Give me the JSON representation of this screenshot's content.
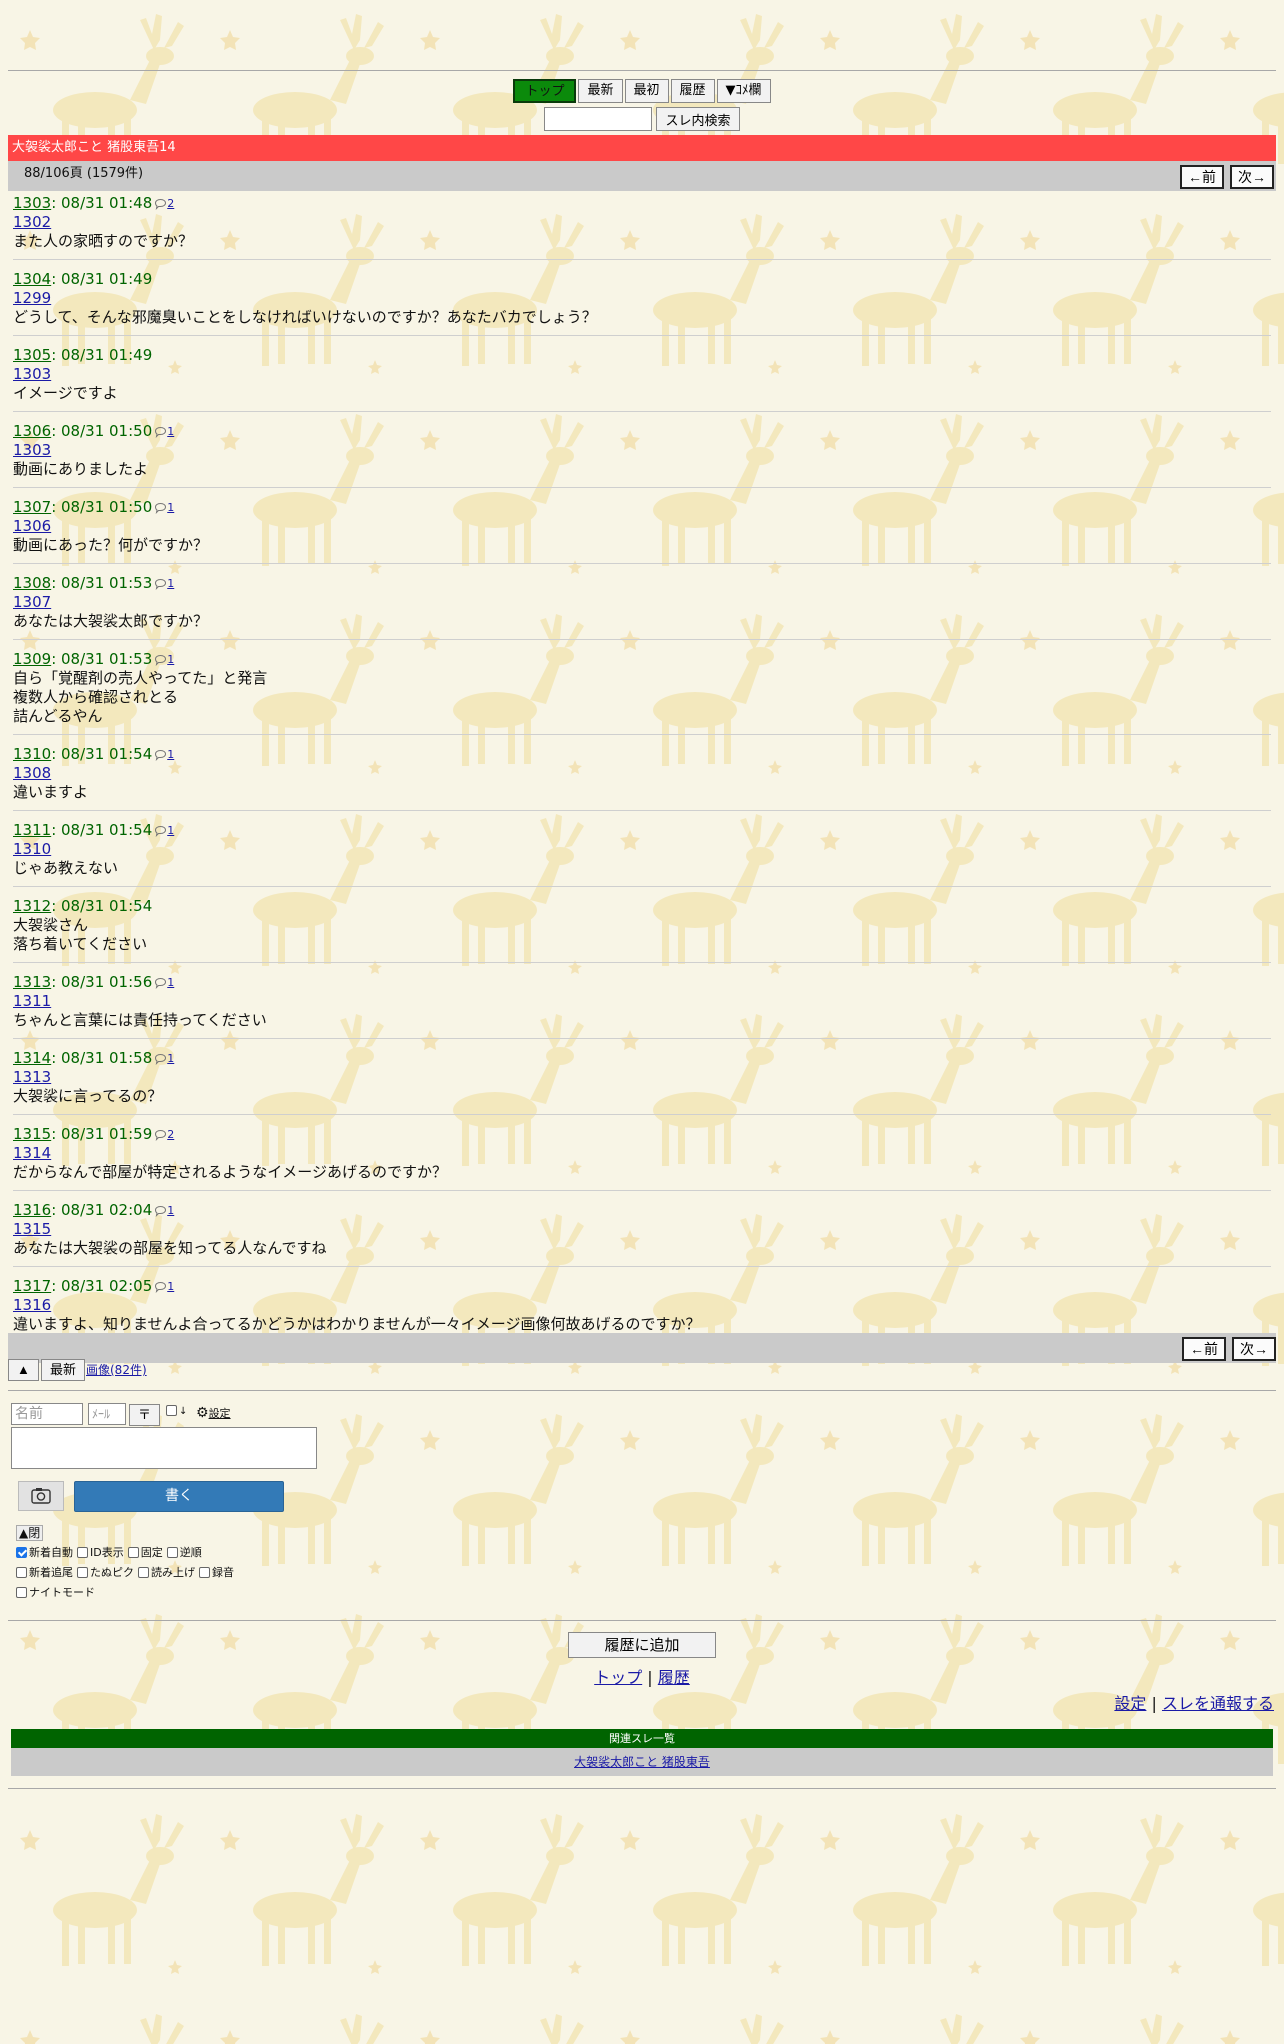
{
  "nav": {
    "buttons": [
      "トップ",
      "最新",
      "最初",
      "履歴",
      "▼ｺﾒ欄"
    ],
    "search_button": "スレ内検索"
  },
  "thread": {
    "title": "大袈裟太郎こと 猪股東吾14",
    "page_info": "88/106頁 (1579件)",
    "prev_label": "←前",
    "next_label": "次→"
  },
  "posts": [
    {
      "num": "1303",
      "datetime": "08/31 01:48",
      "reply_count": "2",
      "anchor": "1302",
      "body": "また人の家晒すのですか？"
    },
    {
      "num": "1304",
      "datetime": "08/31 01:49",
      "reply_count": "",
      "anchor": "1299",
      "body": "どうして、そんな邪魔臭いことをしなければいけないのですか？あなたバカでしょう？"
    },
    {
      "num": "1305",
      "datetime": "08/31 01:49",
      "reply_count": "",
      "anchor": "1303",
      "body": "イメージですよ"
    },
    {
      "num": "1306",
      "datetime": "08/31 01:50",
      "reply_count": "1",
      "anchor": "1303",
      "body": "動画にありましたよ"
    },
    {
      "num": "1307",
      "datetime": "08/31 01:50",
      "reply_count": "1",
      "anchor": "1306",
      "body": "動画にあった？何がですか？"
    },
    {
      "num": "1308",
      "datetime": "08/31 01:53",
      "reply_count": "1",
      "anchor": "1307",
      "body": "あなたは大袈裟太郎ですか？"
    },
    {
      "num": "1309",
      "datetime": "08/31 01:53",
      "reply_count": "1",
      "anchor": "",
      "body": "自ら「覚醒剤の売人やってた」と発言\n複数人から確認されとる\n詰んどるやん"
    },
    {
      "num": "1310",
      "datetime": "08/31 01:54",
      "reply_count": "1",
      "anchor": "1308",
      "body": "違いますよ"
    },
    {
      "num": "1311",
      "datetime": "08/31 01:54",
      "reply_count": "1",
      "anchor": "1310",
      "body": "じゃあ教えない"
    },
    {
      "num": "1312",
      "datetime": "08/31 01:54",
      "reply_count": "",
      "anchor": "",
      "body": "大袈裟さん\n落ち着いてください"
    },
    {
      "num": "1313",
      "datetime": "08/31 01:56",
      "reply_count": "1",
      "anchor": "1311",
      "body": "ちゃんと言葉には責任持ってください"
    },
    {
      "num": "1314",
      "datetime": "08/31 01:58",
      "reply_count": "1",
      "anchor": "1313",
      "body": "大袈裟に言ってるの？"
    },
    {
      "num": "1315",
      "datetime": "08/31 01:59",
      "reply_count": "2",
      "anchor": "1314",
      "body": "だからなんで部屋が特定されるようなイメージあげるのですか？"
    },
    {
      "num": "1316",
      "datetime": "08/31 02:04",
      "reply_count": "1",
      "anchor": "1315",
      "body": "あなたは大袈裟の部屋を知ってる人なんですね"
    },
    {
      "num": "1317",
      "datetime": "08/31 02:05",
      "reply_count": "1",
      "anchor": "1316",
      "body": "違いますよ、知りませんよ合ってるかどうかはわかりませんが一々イメージ画像何故あげるのですか？"
    }
  ],
  "bottom": {
    "up_label": "▲",
    "latest_label": "最新",
    "images_label": "画像(82件)"
  },
  "form": {
    "name_placeholder": "名前",
    "mail_placeholder": "ﾒｰﾙ",
    "down_label": "〒",
    "small_check_label": "↓",
    "settings_label": "設定",
    "post_label": "書く",
    "options_toggle": "▲閉",
    "options": [
      [
        {
          "label": "新着自動",
          "checked": true
        },
        {
          "label": "ID表示",
          "checked": false
        },
        {
          "label": "固定",
          "checked": false
        },
        {
          "label": "逆順",
          "checked": false
        }
      ],
      [
        {
          "label": "新着追尾",
          "checked": false
        },
        {
          "label": "たぬピク",
          "checked": false
        },
        {
          "label": "読み上げ",
          "checked": false
        },
        {
          "label": "録音",
          "checked": false
        }
      ],
      [
        {
          "label": "ナイトモード",
          "checked": false
        }
      ]
    ]
  },
  "footer": {
    "add_history": "履歴に追加",
    "top_link": "トップ",
    "sep": "|",
    "history_link": "履歴",
    "settings_link": "設定",
    "report_link": "スレを通報する",
    "related_header": "関連スレ一覧",
    "related_link": "大袈裟太郎こと 猪股東吾"
  },
  "colors": {
    "title_bar": "#ff4747",
    "active_nav": "#0b8a0b",
    "post_header": "#006400",
    "post_button": "#337ab7",
    "related_header": "#006400",
    "link": "#1a1aa6"
  }
}
